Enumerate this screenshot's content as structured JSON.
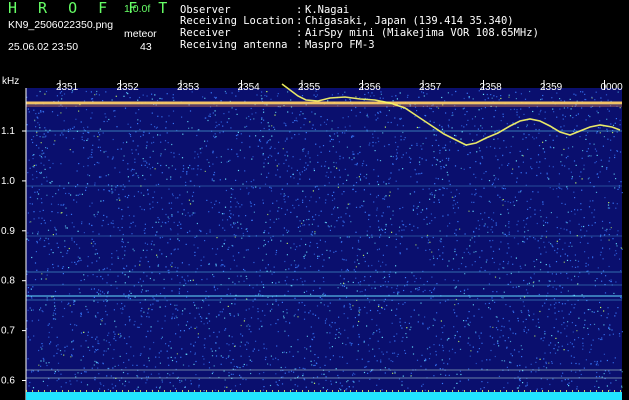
{
  "header": {
    "app_title": "H R O F F T",
    "app_version": "1.0.0f",
    "filename": "KN9_2506022350.png",
    "meteor_label": "meteor",
    "datetime": "25.06.02 23:50",
    "meteor_count": "43",
    "info": [
      {
        "label": "Observer",
        "value": "K.Nagai"
      },
      {
        "label": "Receiving Location",
        "value": "Chigasaki, Japan (139.414 35.340)"
      },
      {
        "label": "Receiver",
        "value": "AirSpy mini (Miakejima VOR 108.65MHz)"
      },
      {
        "label": "Receiving antenna",
        "value": "Maspro FM-3"
      }
    ],
    "colon": ":"
  },
  "spectrogram": {
    "y_unit": "kHz",
    "y_ticks": [
      "1.1",
      "1.0",
      "0.9",
      "0.8",
      "0.7",
      "0.6"
    ],
    "y_tick_values": [
      1.1,
      1.0,
      0.9,
      0.8,
      0.7,
      0.6
    ],
    "y_range": [
      0.58,
      1.16
    ],
    "time_ticks": [
      "2351",
      "2352",
      "2353",
      "2354",
      "2355",
      "2356",
      "2357",
      "2358",
      "2359",
      "0000"
    ],
    "colors": {
      "background": "#0a0f6e",
      "noise_dot": "#3a7cff",
      "noise_bright": "#66e0ff",
      "carrier": "#ffcc66",
      "trace": "#ffff66",
      "bottom_band": "#22e5ff"
    }
  }
}
